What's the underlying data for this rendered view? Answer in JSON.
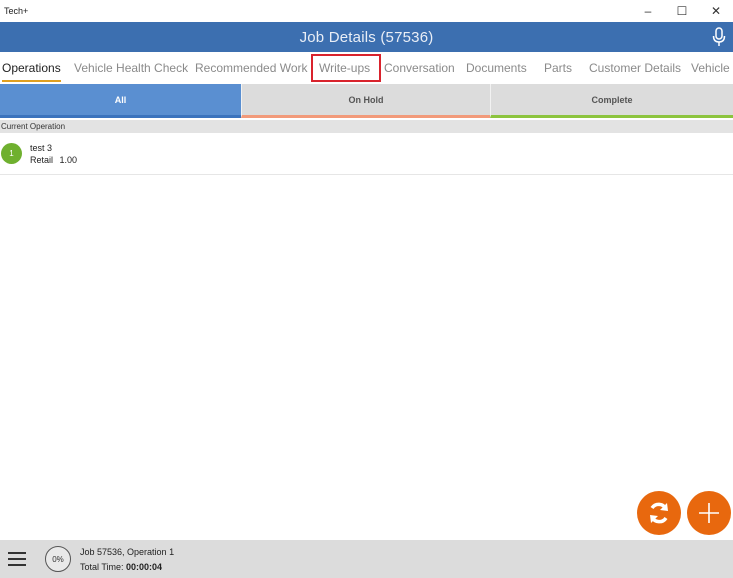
{
  "window": {
    "app_name": "Tech+",
    "minimize": "–",
    "maximize": "☐",
    "close": "✕"
  },
  "header": {
    "title": "Job Details (57536)",
    "mic_icon": "microphone-icon"
  },
  "tabs": [
    {
      "label": "Operations",
      "active": true
    },
    {
      "label": "Vehicle Health Check",
      "active": false
    },
    {
      "label": "Recommended Work",
      "active": false
    },
    {
      "label": "Write-ups",
      "active": false,
      "highlighted": true
    },
    {
      "label": "Conversation",
      "active": false
    },
    {
      "label": "Documents",
      "active": false
    },
    {
      "label": "Parts",
      "active": false
    },
    {
      "label": "Customer Details",
      "active": false
    },
    {
      "label": "Vehicle D",
      "active": false
    }
  ],
  "filters": [
    {
      "label": "All",
      "selected": true,
      "accent": "#3b73bd"
    },
    {
      "label": "On Hold",
      "selected": false,
      "accent": "#f29a7a"
    },
    {
      "label": "Complete",
      "selected": false,
      "accent": "#8cc43e"
    }
  ],
  "section_header": "Current Operation",
  "operations": [
    {
      "number": "1",
      "title": "test 3",
      "rate_type": "Retail",
      "hours": "1.00"
    }
  ],
  "fabs": {
    "refresh_icon": "refresh-icon",
    "add_icon": "plus-icon"
  },
  "bottombar": {
    "menu_icon": "hamburger-icon",
    "progress": "0%",
    "job_line": "Job 57536, Operation 1",
    "time_label": "Total Time:",
    "time_value": "00:00:04"
  },
  "colors": {
    "header_blue": "#3c6fb0",
    "filter_selected": "#5a8fd1",
    "fab_orange": "#e8680e",
    "badge_green": "#6fb02f",
    "highlight_red": "#d9232d"
  }
}
